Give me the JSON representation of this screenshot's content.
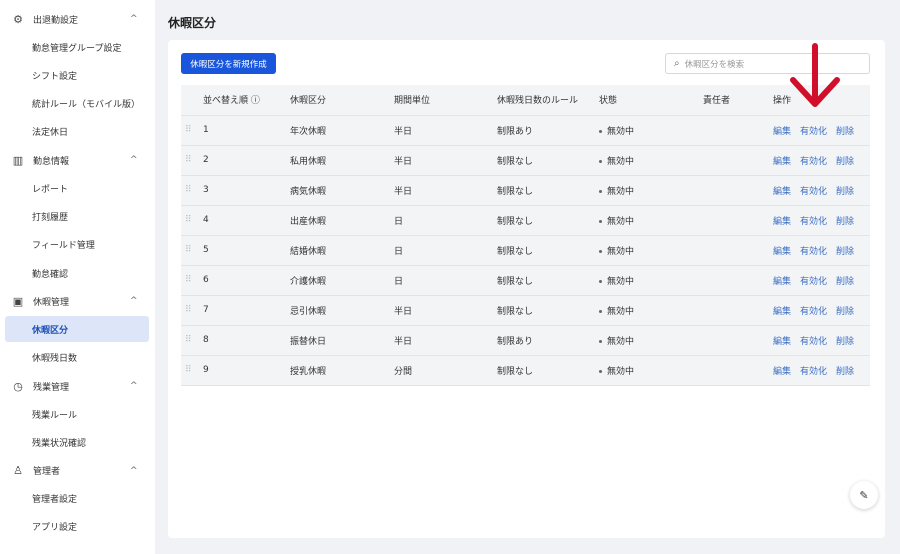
{
  "sidebar": {
    "groups": [
      {
        "label": "出退勤設定",
        "icon": "gear-icon",
        "items": [
          "勤怠管理グループ設定",
          "シフト設定",
          "統計ルール（モバイル版）",
          "法定休日"
        ]
      },
      {
        "label": "勤怠情報",
        "icon": "chart-icon",
        "items": [
          "レポート",
          "打刻履歴",
          "フィールド管理",
          "勤怠確認"
        ]
      },
      {
        "label": "休暇管理",
        "icon": "calendar-icon",
        "items": [
          "休暇区分",
          "休暇残日数"
        ]
      },
      {
        "label": "残業管理",
        "icon": "clock-icon",
        "items": [
          "残業ルール",
          "残業状況確認"
        ]
      },
      {
        "label": "管理者",
        "icon": "user-icon",
        "items": [
          "管理者設定",
          "アプリ設定"
        ]
      }
    ],
    "active": "休暇区分"
  },
  "page": {
    "title": "休暇区分",
    "create_button": "休暇区分を新規作成",
    "search_placeholder": "休暇区分を検索"
  },
  "table": {
    "headers": [
      "並べ替え順 ⓘ",
      "休暇区分",
      "期間単位",
      "休暇残日数のルール",
      "状態",
      "責任者",
      "操作"
    ],
    "actions": [
      "編集",
      "有効化",
      "削除"
    ],
    "rows": [
      [
        "1",
        "年次休暇",
        "半日",
        "制限あり",
        "無効中",
        ""
      ],
      [
        "2",
        "私用休暇",
        "半日",
        "制限なし",
        "無効中",
        ""
      ],
      [
        "3",
        "病気休暇",
        "半日",
        "制限なし",
        "無効中",
        ""
      ],
      [
        "4",
        "出産休暇",
        "日",
        "制限なし",
        "無効中",
        ""
      ],
      [
        "5",
        "結婚休暇",
        "日",
        "制限なし",
        "無効中",
        ""
      ],
      [
        "6",
        "介護休暇",
        "日",
        "制限なし",
        "無効中",
        ""
      ],
      [
        "7",
        "忌引休暇",
        "半日",
        "制限なし",
        "無効中",
        ""
      ],
      [
        "8",
        "振替休日",
        "半日",
        "制限あり",
        "無効中",
        ""
      ],
      [
        "9",
        "授乳休暇",
        "分間",
        "制限なし",
        "無効中",
        ""
      ]
    ]
  },
  "colors": {
    "accent": "#1a56db",
    "link": "#3b6fc4",
    "arrow": "#d0102a"
  }
}
